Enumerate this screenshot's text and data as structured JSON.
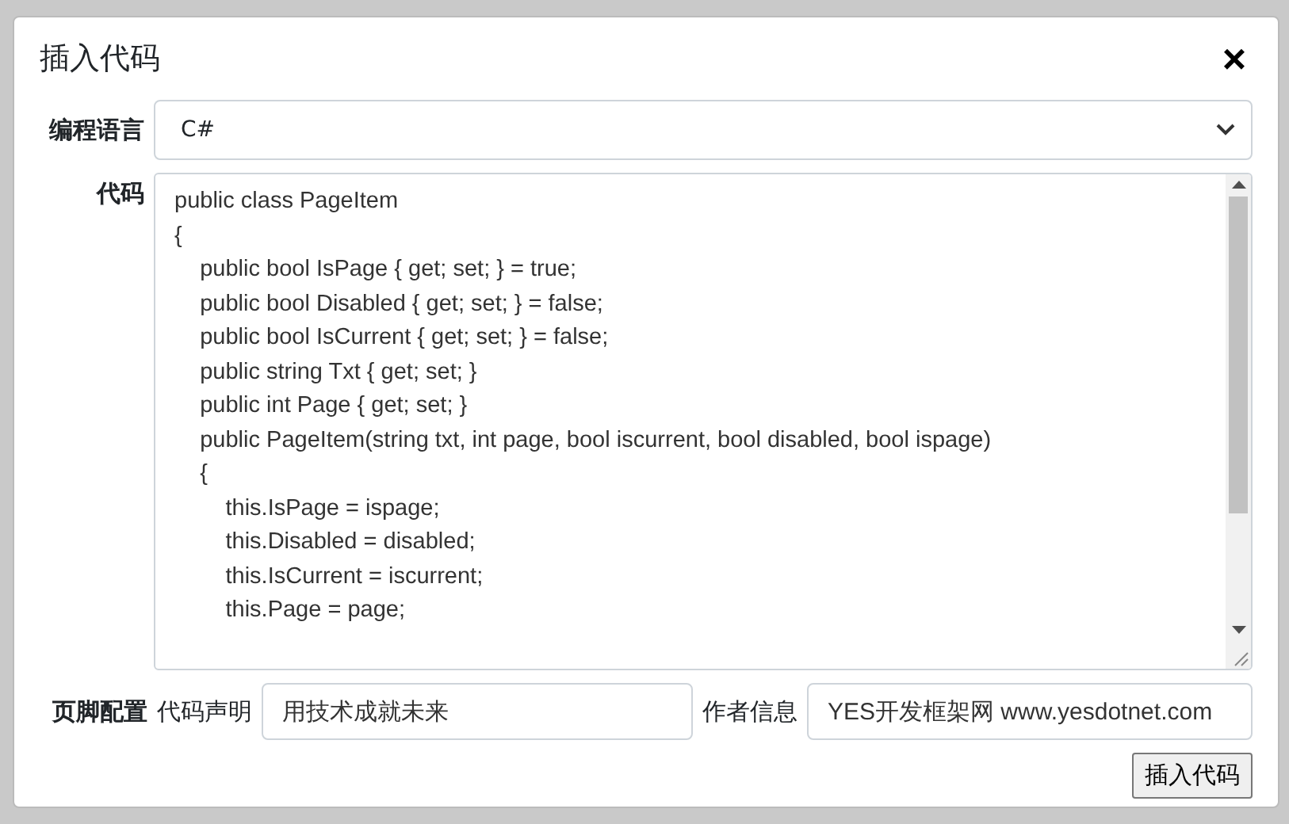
{
  "dialog": {
    "title": "插入代码",
    "close": "×"
  },
  "language": {
    "label": "编程语言",
    "value": "C#"
  },
  "code": {
    "label": "代码",
    "lines": [
      "public class PageItem",
      "{",
      "    public bool IsPage { get; set; } = true;",
      "    public bool Disabled { get; set; } = false;",
      "    public bool IsCurrent { get; set; } = false;",
      "    public string Txt { get; set; }",
      "    public int Page { get; set; }",
      "    public PageItem(string txt, int page, bool iscurrent, bool disabled, bool ispage)",
      "    {",
      "        this.IsPage = ispage;",
      "        this.Disabled = disabled;",
      "        this.IsCurrent = iscurrent;",
      "        this.Page = page;"
    ]
  },
  "footer": {
    "label": "页脚配置",
    "statement_label": "代码声明",
    "statement_value": "用技术成就未来",
    "author_label": "作者信息",
    "author_value": "YES开发框架网 www.yesdotnet.com"
  },
  "submit": "插入代码"
}
